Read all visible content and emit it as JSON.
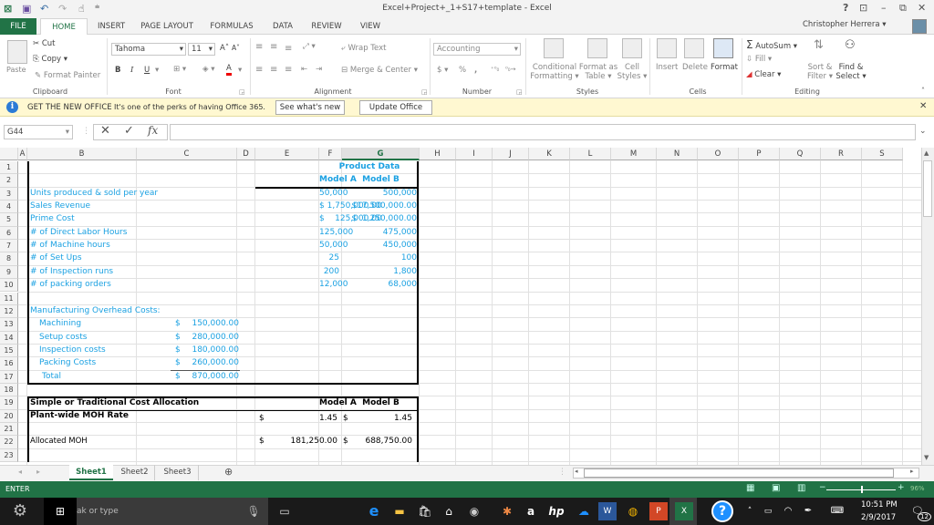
{
  "window": {
    "title": "Excel+Project+_1+S17+template - Excel",
    "help": "?",
    "user": "Christopher Herrera"
  },
  "tabs": [
    "FILE",
    "HOME",
    "INSERT",
    "PAGE LAYOUT",
    "FORMULAS",
    "DATA",
    "REVIEW",
    "VIEW"
  ],
  "ribbon": {
    "clipboard": {
      "paste": "Paste",
      "cut": "Cut",
      "copy": "Copy",
      "format_painter": "Format Painter",
      "label": "Clipboard"
    },
    "font": {
      "name": "Tahoma",
      "size": "11",
      "bold": "B",
      "italic": "I",
      "underline": "U",
      "label": "Font",
      "grow": "A",
      "shrink": "A",
      "color": "A"
    },
    "alignment": {
      "wrap": "Wrap Text",
      "merge": "Merge & Center",
      "label": "Alignment"
    },
    "number": {
      "format": "Accounting",
      "currency": "$",
      "percent": "%",
      "comma": ",",
      "label": "Number"
    },
    "styles": {
      "conditional": "Conditional",
      "conditional2": "Formatting",
      "format_table": "Format as",
      "format_table2": "Table",
      "cell_styles": "Cell",
      "cell_styles2": "Styles",
      "label": "Styles"
    },
    "cells": {
      "insert": "Insert",
      "delete": "Delete",
      "format": "Format",
      "label": "Cells"
    },
    "editing": {
      "autosum": "AutoSum",
      "fill": "Fill",
      "clear": "Clear",
      "sort": "Sort &",
      "sort2": "Filter",
      "find": "Find &",
      "find2": "Select",
      "label": "Editing"
    }
  },
  "infobar": {
    "title": "GET THE NEW OFFICE",
    "message": "It's one of the perks of having Office 365.",
    "btn1": "See what's new",
    "btn2": "Update Office"
  },
  "formula_bar": {
    "name_box": "G44",
    "cancel": "✕",
    "enter": "✓",
    "fx": "fx",
    "value": ""
  },
  "columns": [
    "A",
    "B",
    "C",
    "D",
    "E",
    "F",
    "G",
    "H",
    "I",
    "J",
    "K",
    "L",
    "M",
    "N",
    "O",
    "P",
    "Q",
    "R",
    "S"
  ],
  "rows": [
    "1",
    "2",
    "3",
    "4",
    "5",
    "6",
    "7",
    "8",
    "9",
    "10",
    "11",
    "12",
    "13",
    "14",
    "15",
    "16",
    "17",
    "18",
    "19",
    "20",
    "21",
    "22",
    "23"
  ],
  "sheet": {
    "product_data_title": "Product Data",
    "model_a": "Model A",
    "model_b": "Model B",
    "product_rows": [
      {
        "label": "Units produced & sold per year",
        "a": "50,000",
        "b": "500,000"
      },
      {
        "label": "Sales Revenue",
        "a": "$ 1,750,000.00",
        "b": "$17,500,000.00"
      },
      {
        "label": "Prime Cost",
        "a": "$    125,000.00",
        "b": "$  1,250,000.00"
      },
      {
        "label": "# of Direct Labor Hours",
        "a": "125,000",
        "b": "475,000"
      },
      {
        "label": "# of Machine hours",
        "a": "50,000",
        "b": "450,000"
      },
      {
        "label": "# of Set Ups",
        "a": "25",
        "b": "100"
      },
      {
        "label": "# of Inspection runs",
        "a": "200",
        "b": "1,800"
      },
      {
        "label": "# of packing orders",
        "a": "12,000",
        "b": "68,000"
      }
    ],
    "moh_title": "Manufacturing Overhead Costs:",
    "moh_rows": [
      {
        "label": "Machining",
        "cur": "$",
        "value": "150,000.00"
      },
      {
        "label": "Setup costs",
        "cur": "$",
        "value": "280,000.00"
      },
      {
        "label": "Inspection costs",
        "cur": "$",
        "value": "180,000.00"
      },
      {
        "label": "Packing Costs",
        "cur": "$",
        "value": "260,000.00"
      },
      {
        "label": "Total",
        "cur": "$",
        "value": "870,000.00"
      }
    ],
    "alloc_title": "Simple or Traditional Cost Allocation",
    "alloc_model_a": "Model A",
    "alloc_model_b": "Model B",
    "rate_label": "Plant-wide MOH Rate",
    "rate_a_cur": "$",
    "rate_a": "1.45",
    "rate_b_cur": "$",
    "rate_b": "1.45",
    "allocated_label": "Allocated MOH",
    "allocated_a_cur": "$",
    "allocated_a": "181,250.00",
    "allocated_b_cur": "$",
    "allocated_b": "688,750.00"
  },
  "sheet_tabs": [
    "Sheet1",
    "Sheet2",
    "Sheet3"
  ],
  "active_sheet": "Sheet1",
  "status": {
    "mode": "ENTER",
    "zoom": "96%"
  },
  "taskbar": {
    "search_placeholder": "ak or type",
    "time": "10:51 PM",
    "date": "2/9/2017",
    "notifications": "12"
  },
  "colors": {
    "excel_green": "#217346",
    "cell_blue": "#1ba1e2",
    "info_yellow": "#fff8d1"
  }
}
